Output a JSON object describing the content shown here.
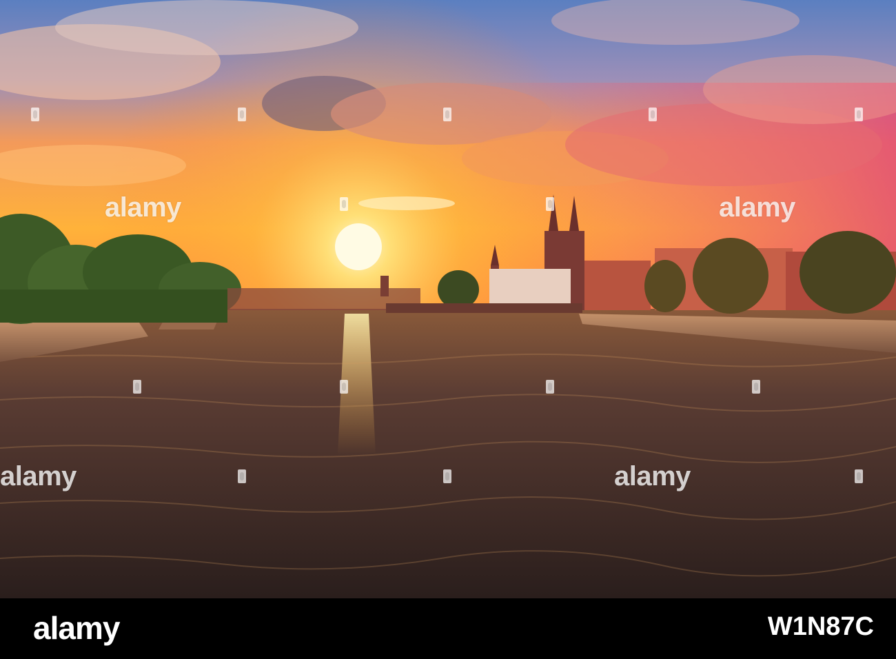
{
  "watermark": {
    "brand": "alamy"
  },
  "footer": {
    "logo": "alamy",
    "image_code": "W1N87C"
  },
  "colors": {
    "sky_top": "#3b6bb0",
    "sky_horizon": "#ffb23a",
    "sun": "#fff6c8",
    "river": "#3a2a26",
    "river_reflection": "#ffcf5a",
    "trees": "#2f4a22",
    "buildings_warm": "#b8543f",
    "footer_bg": "#000000"
  }
}
